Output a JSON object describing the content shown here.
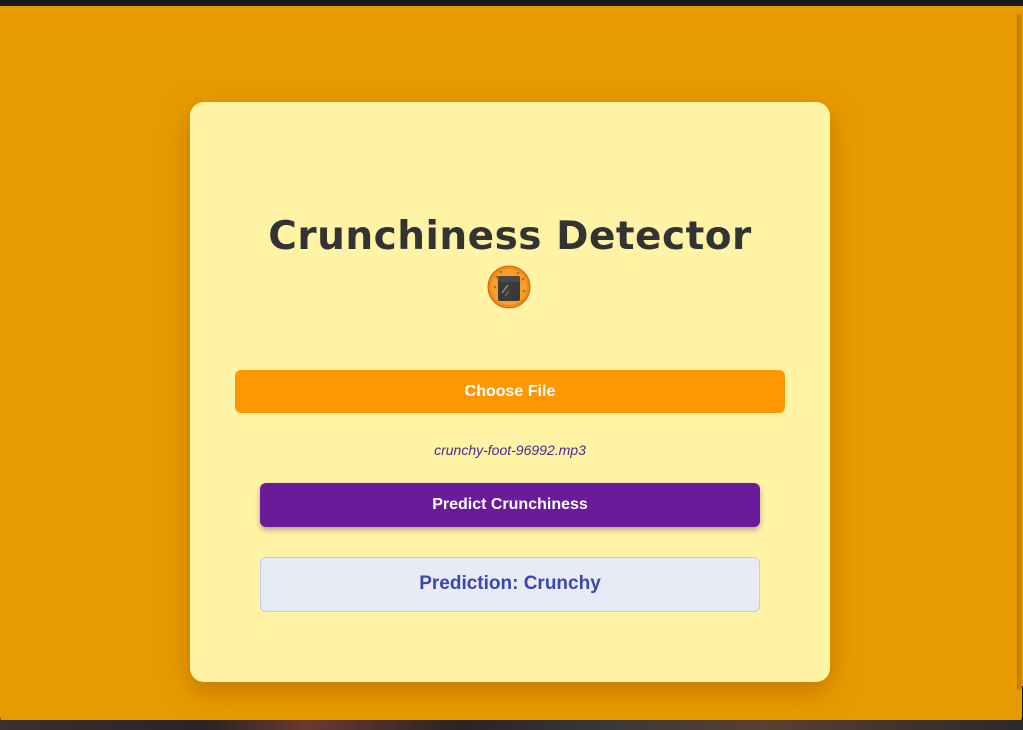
{
  "app": {
    "title": "Crunchiness Detector",
    "title_icon": "cookie-icon"
  },
  "upload": {
    "choose_label": "Choose File",
    "file_name": "crunchy-foot-96992.mp3"
  },
  "actions": {
    "predict_label": "Predict Crunchiness"
  },
  "result": {
    "text": "Prediction: Crunchy"
  },
  "colors": {
    "page_background": "#e89b00",
    "card_background": "#fff3a6",
    "choose_button": "#ff9800",
    "predict_button": "#6a1b9a",
    "result_background": "#e8eaf6",
    "result_text": "#3949ab",
    "title_text": "#333333"
  }
}
